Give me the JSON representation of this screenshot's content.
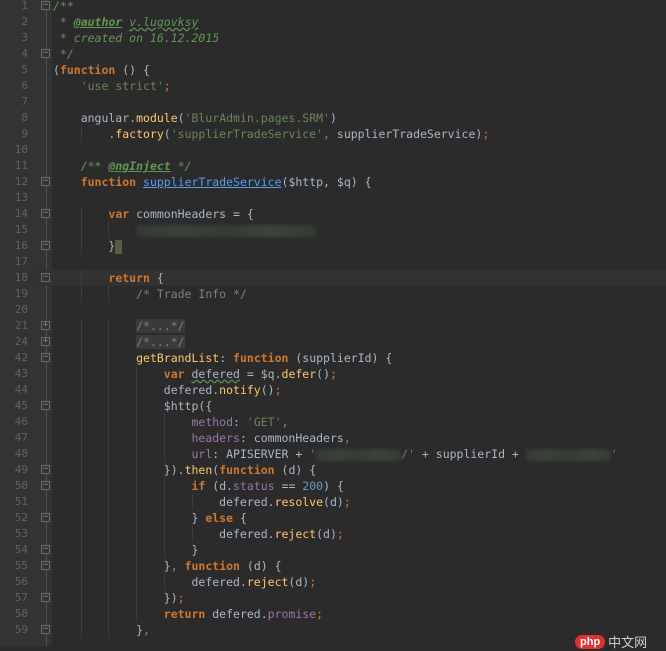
{
  "editor": {
    "theme_colors": {
      "background": "#2b2b2b",
      "keyword": "#cc7832",
      "string": "#6a8759",
      "comment": "#808080",
      "doc": "#629755",
      "function": "#ffc66d",
      "property": "#9876aa",
      "number": "#6897bb",
      "text": "#a9b7c6"
    },
    "current_line": 18,
    "lines": [
      {
        "n": "1",
        "fold": "open",
        "t": [
          [
            "/**",
            "doc"
          ]
        ]
      },
      {
        "n": "2",
        "t": [
          [
            " * ",
            "doc"
          ],
          [
            "@author",
            "doctag"
          ],
          [
            " ",
            "doc"
          ],
          [
            "v.lugovksy",
            "doc wavy"
          ]
        ]
      },
      {
        "n": "3",
        "t": [
          [
            " * created on 16.12.2015",
            "doc"
          ]
        ]
      },
      {
        "n": "4",
        "fold": "close",
        "t": [
          [
            " */",
            "doc"
          ]
        ]
      },
      {
        "n": "5",
        "t": [
          [
            "(",
            ""
          ],
          [
            "function",
            "kw bold"
          ],
          [
            " () {",
            ""
          ]
        ]
      },
      {
        "n": "6",
        "t": [
          [
            "    ",
            ""
          ],
          [
            "'use strict'",
            "str"
          ],
          [
            ";",
            "kw"
          ]
        ]
      },
      {
        "n": "7",
        "t": []
      },
      {
        "n": "8",
        "t": [
          [
            "    angular.",
            ""
          ],
          [
            "module",
            "fn"
          ],
          [
            "(",
            ""
          ],
          [
            "'BlurAdmin.pages.SRM'",
            "str"
          ],
          [
            ")",
            ""
          ]
        ]
      },
      {
        "n": "9",
        "t": [
          [
            "        .",
            ""
          ],
          [
            "factory",
            "fn"
          ],
          [
            "(",
            ""
          ],
          [
            "'supplierTradeService'",
            "str"
          ],
          [
            ",",
            "kw"
          ],
          [
            " supplierTradeService)",
            ""
          ],
          [
            ";",
            "kw"
          ]
        ]
      },
      {
        "n": "10",
        "t": []
      },
      {
        "n": "11",
        "t": [
          [
            "    ",
            ""
          ],
          [
            "/** ",
            "doc"
          ],
          [
            "@ngInject",
            "doctag"
          ],
          [
            " */",
            "doc"
          ]
        ]
      },
      {
        "n": "12",
        "fold": "open",
        "t": [
          [
            "    ",
            ""
          ],
          [
            "function",
            "kw bold"
          ],
          [
            " ",
            ""
          ],
          [
            "supplierTradeService",
            "link"
          ],
          [
            "($http, $q) {",
            ""
          ]
        ]
      },
      {
        "n": "13",
        "t": []
      },
      {
        "n": "14",
        "fold": "open",
        "t": [
          [
            "        ",
            ""
          ],
          [
            "var",
            "kw bold"
          ],
          [
            " commonHeaders = {",
            ""
          ]
        ]
      },
      {
        "n": "15",
        "t": [
          [
            "            ",
            ""
          ],
          [
            "",
            "blur"
          ]
        ]
      },
      {
        "n": "16",
        "fold": "close",
        "t": [
          [
            "        }",
            ""
          ],
          [
            "",
            "caret"
          ]
        ]
      },
      {
        "n": "17",
        "t": []
      },
      {
        "n": "18",
        "fold": "open",
        "t": [
          [
            "        ",
            ""
          ],
          [
            "return",
            "kw bold"
          ],
          [
            " {",
            ""
          ]
        ]
      },
      {
        "n": "19",
        "t": [
          [
            "            ",
            ""
          ],
          [
            "/* Trade Info */",
            "cmt"
          ]
        ]
      },
      {
        "n": "20",
        "t": []
      },
      {
        "n": "21",
        "fold": "plus",
        "t": [
          [
            "            ",
            ""
          ],
          [
            "/*...*/",
            "foldtxt"
          ]
        ]
      },
      {
        "n": "24",
        "fold": "plus",
        "t": [
          [
            "            ",
            ""
          ],
          [
            "/*...*/",
            "foldtxt"
          ]
        ]
      },
      {
        "n": "42",
        "fold": "open",
        "t": [
          [
            "            ",
            ""
          ],
          [
            "getBrandList",
            "fn"
          ],
          [
            ": ",
            ""
          ],
          [
            "function",
            "kw bold"
          ],
          [
            " (supplierId) {",
            ""
          ]
        ]
      },
      {
        "n": "43",
        "t": [
          [
            "                ",
            ""
          ],
          [
            "var",
            "kw bold"
          ],
          [
            " ",
            ""
          ],
          [
            "defered",
            "wavy"
          ],
          [
            " = $q.",
            ""
          ],
          [
            "defer",
            "fn"
          ],
          [
            "()",
            ""
          ],
          [
            ";",
            "kw"
          ]
        ]
      },
      {
        "n": "44",
        "t": [
          [
            "                defered.",
            ""
          ],
          [
            "notify",
            "fn"
          ],
          [
            "()",
            ""
          ],
          [
            ";",
            "kw"
          ]
        ]
      },
      {
        "n": "45",
        "fold": "open",
        "t": [
          [
            "                $http({",
            ""
          ]
        ]
      },
      {
        "n": "46",
        "t": [
          [
            "                    ",
            ""
          ],
          [
            "method",
            "prop"
          ],
          [
            ": ",
            ""
          ],
          [
            "'GET'",
            "str"
          ],
          [
            ",",
            "kw"
          ]
        ]
      },
      {
        "n": "47",
        "t": [
          [
            "                    ",
            ""
          ],
          [
            "headers",
            "prop"
          ],
          [
            ": commonHeaders",
            ""
          ],
          [
            ",",
            "kw"
          ]
        ]
      },
      {
        "n": "48",
        "t": [
          [
            "                    ",
            ""
          ],
          [
            "url",
            "prop"
          ],
          [
            ": APISERVER + ",
            ""
          ],
          [
            "'",
            "str"
          ],
          [
            "",
            "blur"
          ],
          [
            "/'",
            "str"
          ],
          [
            " + supplierId + ",
            ""
          ],
          [
            "",
            "blur"
          ],
          [
            "'",
            "str"
          ]
        ]
      },
      {
        "n": "49",
        "fold": "close",
        "t": [
          [
            "                }).",
            ""
          ],
          [
            "then",
            "fn"
          ],
          [
            "(",
            ""
          ],
          [
            "function",
            "kw bold"
          ],
          [
            " (d) {",
            ""
          ]
        ]
      },
      {
        "n": "50",
        "fold": "open",
        "t": [
          [
            "                    ",
            ""
          ],
          [
            "if",
            "kw bold"
          ],
          [
            " (d.",
            ""
          ],
          [
            "status",
            "prop"
          ],
          [
            " == ",
            ""
          ],
          [
            "200",
            "num"
          ],
          [
            ") {",
            ""
          ]
        ]
      },
      {
        "n": "51",
        "t": [
          [
            "                        defered.",
            ""
          ],
          [
            "resolve",
            "fn"
          ],
          [
            "(d)",
            ""
          ],
          [
            ";",
            "kw"
          ]
        ]
      },
      {
        "n": "52",
        "fold": "close",
        "t": [
          [
            "                    } ",
            ""
          ],
          [
            "else",
            "kw bold"
          ],
          [
            " {",
            ""
          ]
        ]
      },
      {
        "n": "53",
        "t": [
          [
            "                        defered.",
            ""
          ],
          [
            "reject",
            "fn"
          ],
          [
            "(d)",
            ""
          ],
          [
            ";",
            "kw"
          ]
        ]
      },
      {
        "n": "54",
        "fold": "close",
        "t": [
          [
            "                    }",
            ""
          ]
        ]
      },
      {
        "n": "55",
        "fold": "open",
        "t": [
          [
            "                }",
            ""
          ],
          [
            ",",
            "kw"
          ],
          [
            " ",
            ""
          ],
          [
            "function",
            "kw bold"
          ],
          [
            " (d) {",
            ""
          ]
        ]
      },
      {
        "n": "56",
        "t": [
          [
            "                    defered.",
            ""
          ],
          [
            "reject",
            "fn"
          ],
          [
            "(d)",
            ""
          ],
          [
            ";",
            "kw"
          ]
        ]
      },
      {
        "n": "57",
        "fold": "close",
        "t": [
          [
            "                })",
            ""
          ],
          [
            ";",
            "kw"
          ]
        ]
      },
      {
        "n": "58",
        "t": [
          [
            "                ",
            ""
          ],
          [
            "return",
            "kw bold"
          ],
          [
            " defered.",
            ""
          ],
          [
            "promise",
            "prop"
          ],
          [
            ";",
            "kw"
          ]
        ]
      },
      {
        "n": "59",
        "fold": "close",
        "t": [
          [
            "            }",
            ""
          ],
          [
            ",",
            "kw"
          ]
        ]
      }
    ]
  },
  "watermark": {
    "logo": "php",
    "text": "中文网"
  }
}
